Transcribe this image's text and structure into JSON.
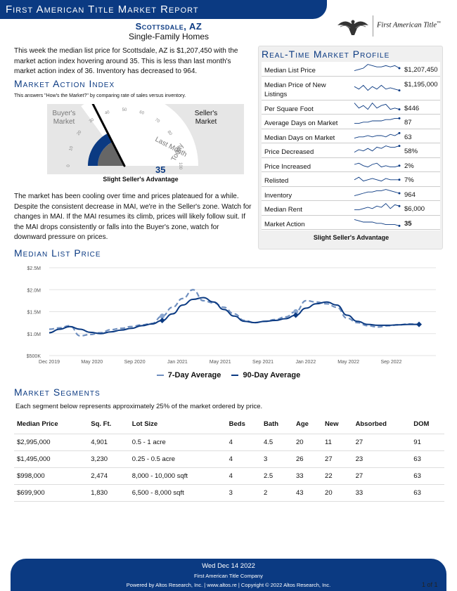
{
  "header": {
    "title": "First American Title Market Report",
    "brand": "First American Title",
    "brand_mark": "™",
    "city": "Scottsdale, AZ",
    "subtitle": "Single-Family Homes"
  },
  "intro": "This week the median list price for Scottsdale, AZ is $1,207,450 with the market action index hovering around 35. This is less than last month's market action index of 36. Inventory has decreased to 964.",
  "mai": {
    "title": "Market Action Index",
    "note": "This answers \"How's the Market?\" by comparing rate of sales versus inventory.",
    "buyers": "Buyer's Market",
    "sellers": "Seller's Market",
    "last_month": "Last Month",
    "today": "Today",
    "value": 35,
    "value_text": "35",
    "last_month_value": 36,
    "ticks": [
      "0",
      "10",
      "20",
      "30",
      "40",
      "50",
      "60",
      "70",
      "80",
      "90",
      "100"
    ],
    "label": "Slight Seller's Advantage"
  },
  "analysis": "The market has been cooling over time and prices plateaued for a while. Despite the consistent decrease in MAI, we're in the Seller's zone. Watch for changes in MAI. If the MAI resumes its climb, prices will likely follow suit. If the MAI drops consistently or falls into the Buyer's zone, watch for downward pressure on prices.",
  "profile": {
    "title": "Real-Time Market Profile",
    "rows": [
      {
        "label": "Median List Price",
        "value": "$1,207,450"
      },
      {
        "label": "Median Price of New Listings",
        "value": "$1,195,000"
      },
      {
        "label": "Per Square Foot",
        "value": "$446"
      },
      {
        "label": "Average Days on Market",
        "value": "87"
      },
      {
        "label": "Median Days on Market",
        "value": "63"
      },
      {
        "label": "Price Decreased",
        "value": "58%"
      },
      {
        "label": "Price Increased",
        "value": "2%"
      },
      {
        "label": "Relisted",
        "value": "7%"
      },
      {
        "label": "Inventory",
        "value": "964"
      },
      {
        "label": "Median Rent",
        "value": "$6,000"
      },
      {
        "label": "Market Action",
        "value": "35"
      }
    ],
    "footer": "Slight Seller's Advantage"
  },
  "chart_data": {
    "type": "line",
    "title": "Median List Price",
    "x_ticks": [
      "Dec 2019",
      "May 2020",
      "Sep 2020",
      "Jan 2021",
      "May 2021",
      "Sep 2021",
      "Jan 2022",
      "May 2022",
      "Sep 2022"
    ],
    "y_ticks": [
      "$500K",
      "$1.0M",
      "$1.5M",
      "$2.0M",
      "$2.5M"
    ],
    "ylim": [
      500000,
      2500000
    ],
    "x": [
      0,
      1,
      2,
      3,
      4,
      5,
      6,
      7,
      8,
      9,
      10,
      11,
      12,
      13,
      14,
      15,
      16,
      17,
      18,
      19,
      20,
      21,
      22,
      23,
      24,
      25,
      26,
      27,
      28,
      29,
      30,
      31,
      32,
      33,
      34,
      35,
      36
    ],
    "series": [
      {
        "name": "7-Day Average",
        "values": [
          1100000,
          1130000,
          1180000,
          950000,
          980000,
          1020000,
          1090000,
          1120000,
          1160000,
          1200000,
          1230000,
          1400000,
          1600000,
          1800000,
          2000000,
          1750000,
          1700000,
          1600000,
          1450000,
          1300000,
          1250000,
          1280000,
          1320000,
          1380000,
          1500000,
          1750000,
          1720000,
          1680000,
          1600000,
          1350000,
          1250000,
          1180000,
          1150000,
          1180000,
          1200000,
          1220000,
          1210000
        ]
      },
      {
        "name": "90-Day Average",
        "values": [
          1020000,
          1100000,
          1160000,
          1100000,
          1030000,
          1000000,
          1040000,
          1080000,
          1120000,
          1180000,
          1220000,
          1300000,
          1450000,
          1650000,
          1780000,
          1820000,
          1720000,
          1550000,
          1400000,
          1280000,
          1250000,
          1280000,
          1300000,
          1340000,
          1420000,
          1580000,
          1680000,
          1720000,
          1650000,
          1420000,
          1280000,
          1210000,
          1190000,
          1190000,
          1200000,
          1210000,
          1210000
        ]
      }
    ]
  },
  "legend": {
    "seven_day": "7-Day Average",
    "ninety_day": "90-Day Average"
  },
  "segments": {
    "title": "Market Segments",
    "note": "Each segment below represents approximately 25% of the market ordered by price.",
    "columns": [
      "Median Price",
      "Sq. Ft.",
      "Lot Size",
      "Beds",
      "Bath",
      "Age",
      "New",
      "Absorbed",
      "DOM"
    ],
    "rows": [
      [
        "$2,995,000",
        "4,901",
        "0.5 - 1 acre",
        "4",
        "4.5",
        "20",
        "11",
        "27",
        "91"
      ],
      [
        "$1,495,000",
        "3,230",
        "0.25 - 0.5 acre",
        "4",
        "3",
        "26",
        "27",
        "23",
        "63"
      ],
      [
        "$998,000",
        "2,474",
        "8,000 - 10,000 sqft",
        "4",
        "2.5",
        "33",
        "22",
        "27",
        "63"
      ],
      [
        "$699,900",
        "1,830",
        "6,500 - 8,000 sqft",
        "3",
        "2",
        "43",
        "20",
        "33",
        "63"
      ]
    ]
  },
  "footer": {
    "date": "Wed Dec 14 2022",
    "company": "First American Title Company",
    "powered": "Powered by Altos Research, Inc. | www.altos.re | Copyright © 2022 Altos Research, Inc.",
    "page": "1 of 1"
  },
  "colors": {
    "brand": "#0b3a82",
    "seven_day": "#6f8fbf",
    "ninety_day": "#0b3a82"
  }
}
